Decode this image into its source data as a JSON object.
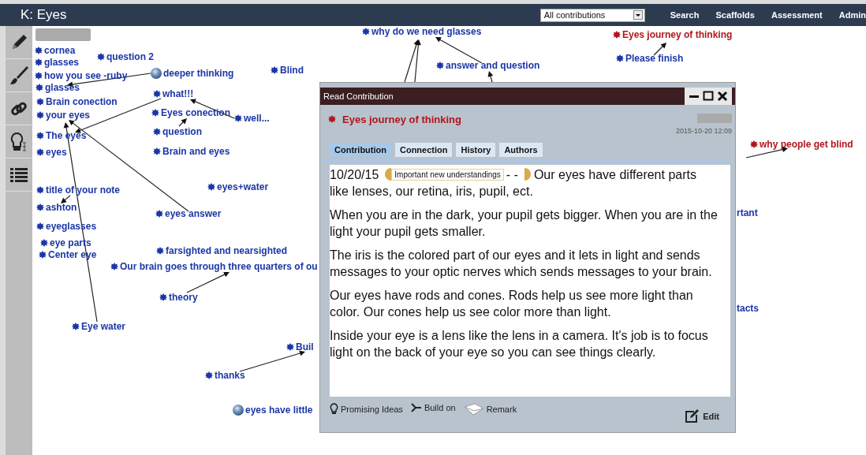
{
  "app": {
    "title": "K: Eyes",
    "filter": {
      "value": "All contributions"
    },
    "nav": [
      "Search",
      "Scaffolds",
      "Assessment",
      "Admin"
    ]
  },
  "notes": [
    {
      "title": "cornea",
      "kind": "note",
      "color": "#1b36a6"
    },
    {
      "title": "glasses",
      "kind": "note",
      "color": "#1b36a6"
    },
    {
      "title": "question 2",
      "kind": "note",
      "color": "#1b36a6"
    },
    {
      "title": "how you see -ruby",
      "kind": "note",
      "color": "#1b36a6"
    },
    {
      "title": "deeper thinking",
      "kind": "rise_above",
      "color": "#1b36a6"
    },
    {
      "title": "Blind",
      "kind": "note",
      "color": "#1b36a6"
    },
    {
      "title": "glasses",
      "kind": "note",
      "color": "#1b36a6"
    },
    {
      "title": "what!!!",
      "kind": "note",
      "color": "#1b36a6"
    },
    {
      "title": "Brain conection",
      "kind": "note",
      "color": "#1b36a6"
    },
    {
      "title": "your eyes",
      "kind": "note",
      "color": "#1b36a6"
    },
    {
      "title": "Eyes conection",
      "kind": "note",
      "color": "#1b36a6"
    },
    {
      "title": "well...",
      "kind": "note",
      "color": "#1b36a6"
    },
    {
      "title": "question",
      "kind": "note",
      "color": "#1b36a6"
    },
    {
      "title": "The eyes",
      "kind": "note",
      "color": "#1b36a6"
    },
    {
      "title": "eyes",
      "kind": "note",
      "color": "#1b36a6"
    },
    {
      "title": "Brain and eyes",
      "kind": "note",
      "color": "#1b36a6"
    },
    {
      "title": "title of your note",
      "kind": "note",
      "color": "#1b36a6"
    },
    {
      "title": "eyes+water",
      "kind": "note",
      "color": "#1b36a6"
    },
    {
      "title": "ashton",
      "kind": "note",
      "color": "#1b36a6"
    },
    {
      "title": "eyes answer",
      "kind": "note",
      "color": "#1b36a6"
    },
    {
      "title": "eyeglasses",
      "kind": "note",
      "color": "#1b36a6"
    },
    {
      "title": "eye parts",
      "kind": "note",
      "color": "#1b36a6"
    },
    {
      "title": "Center eye",
      "kind": "note",
      "color": "#1b36a6"
    },
    {
      "title": "farsighted and nearsighted",
      "kind": "note",
      "color": "#1b36a6"
    },
    {
      "title": "Our brain goes through three quarters of ou",
      "kind": "note",
      "color": "#1b36a6"
    },
    {
      "title": "theory",
      "kind": "note",
      "color": "#1b36a6"
    },
    {
      "title": "Eye water",
      "kind": "note",
      "color": "#1b36a6"
    },
    {
      "title": "Buil",
      "kind": "note",
      "color": "#1b36a6"
    },
    {
      "title": "thanks",
      "kind": "note",
      "color": "#1b36a6"
    },
    {
      "title": "eyes have little",
      "kind": "rise_above",
      "color": "#1b36a6"
    },
    {
      "title": "why do we need glasses",
      "kind": "note",
      "color": "#1b36a6"
    },
    {
      "title": "answer and question",
      "kind": "note",
      "color": "#1b36a6"
    },
    {
      "title": "Eyes journey of thinking",
      "kind": "note",
      "color": "#b0151b"
    },
    {
      "title": "Please finish",
      "kind": "note",
      "color": "#1b36a6"
    },
    {
      "title": "why people get blind",
      "kind": "note",
      "color": "#b0151b"
    },
    {
      "title": "rtant",
      "kind": "fragment",
      "color": "#1b36a6"
    },
    {
      "title": "tacts",
      "kind": "fragment",
      "color": "#1b36a6"
    }
  ],
  "dialog": {
    "title": "Read Contribution",
    "note_title": "Eyes journey of thinking",
    "date": "2015-10-20 12:09",
    "tabs": [
      {
        "label": "Contribution",
        "selected": true
      },
      {
        "label": "Connection",
        "selected": false
      },
      {
        "label": "History",
        "selected": false
      },
      {
        "label": "Authors",
        "selected": false
      }
    ],
    "body": {
      "date": "10/20/15",
      "scaffold": "Important new understandings",
      "separator": "- -",
      "lead": [
        "Our eyes have different parts",
        "like lenses, our retina, iris, pupil, ect."
      ],
      "paragraphs": [
        "When you are in the dark, your pupil gets bigger. When you are in the light your pupil gets smaller.",
        "The iris is the colored part of our eyes and it lets in light and sends messages to your optic nerves which sends messages to your brain.",
        "Our eyes have rods and cones. Rods help us see more light than color. Our cones help us see color more than light.",
        "Inside your eye is a lens like the lens in a camera. It's job is to focus light on the back of your eye so you can see things clearly."
      ]
    },
    "actions": [
      {
        "label": "Promising Ideas",
        "kind": "promising"
      },
      {
        "label": "Build on",
        "kind": "buildon"
      },
      {
        "label": "Remark",
        "kind": "remark"
      }
    ],
    "edit": "Edit"
  }
}
